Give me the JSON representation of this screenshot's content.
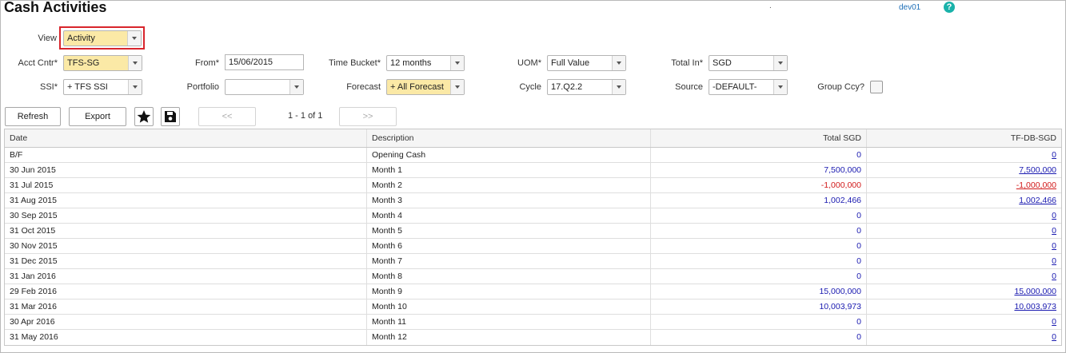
{
  "header": {
    "title": "Cash Activities",
    "dot": ".",
    "user": "dev01",
    "help_label": "?"
  },
  "filters": {
    "view": {
      "label": "View",
      "value": "Activity"
    },
    "acct_cntr": {
      "label": "Acct Cntr*",
      "value": "TFS-SG"
    },
    "from": {
      "label": "From*",
      "value": "15/06/2015"
    },
    "time_bucket": {
      "label": "Time Bucket*",
      "value": "12 months"
    },
    "uom": {
      "label": "UOM*",
      "value": "Full Value"
    },
    "total_in": {
      "label": "Total In*",
      "value": "SGD"
    },
    "ssi": {
      "label": "SSI*",
      "value": "+ TFS SSI"
    },
    "portfolio": {
      "label": "Portfolio",
      "value": ""
    },
    "forecast": {
      "label": "Forecast",
      "value": "+ All Forecast"
    },
    "cycle": {
      "label": "Cycle",
      "value": "17.Q2.2"
    },
    "source": {
      "label": "Source",
      "value": "-DEFAULT-"
    },
    "group_ccy": {
      "label": "Group Ccy?"
    }
  },
  "toolbar": {
    "refresh_label": "Refresh",
    "export_label": "Export",
    "prev_label": "<<",
    "next_label": ">>",
    "pager_text": "1 - 1 of 1"
  },
  "table": {
    "columns": [
      "Date",
      "Description",
      "Total SGD",
      "TF-DB-SGD"
    ],
    "rows": [
      {
        "date": "B/F",
        "desc": "Opening Cash",
        "total": "0",
        "tfdb": "0",
        "neg": false
      },
      {
        "date": "30 Jun 2015",
        "desc": "Month 1",
        "total": "7,500,000",
        "tfdb": "7,500,000",
        "neg": false
      },
      {
        "date": "31 Jul 2015",
        "desc": "Month 2",
        "total": "-1,000,000",
        "tfdb": "-1,000,000",
        "neg": true
      },
      {
        "date": "31 Aug 2015",
        "desc": "Month 3",
        "total": "1,002,466",
        "tfdb": "1,002,466",
        "neg": false
      },
      {
        "date": "30 Sep 2015",
        "desc": "Month 4",
        "total": "0",
        "tfdb": "0",
        "neg": false
      },
      {
        "date": "31 Oct 2015",
        "desc": "Month 5",
        "total": "0",
        "tfdb": "0",
        "neg": false
      },
      {
        "date": "30 Nov 2015",
        "desc": "Month 6",
        "total": "0",
        "tfdb": "0",
        "neg": false
      },
      {
        "date": "31 Dec 2015",
        "desc": "Month 7",
        "total": "0",
        "tfdb": "0",
        "neg": false
      },
      {
        "date": "31 Jan 2016",
        "desc": "Month 8",
        "total": "0",
        "tfdb": "0",
        "neg": false
      },
      {
        "date": "29 Feb 2016",
        "desc": "Month 9",
        "total": "15,000,000",
        "tfdb": "15,000,000",
        "neg": false
      },
      {
        "date": "31 Mar 2016",
        "desc": "Month 10",
        "total": "10,003,973",
        "tfdb": "10,003,973",
        "neg": false
      },
      {
        "date": "30 Apr 2016",
        "desc": "Month 11",
        "total": "0",
        "tfdb": "0",
        "neg": false
      },
      {
        "date": "31 May 2016",
        "desc": "Month 12",
        "total": "0",
        "tfdb": "0",
        "neg": false
      }
    ]
  },
  "colors": {
    "positive": "#1a1ab0",
    "negative": "#d11a1a",
    "highlight_border": "#d8252c",
    "required_field": "#fbe9a6",
    "help_icon": "#1ab2aa"
  },
  "icons": {
    "favorite": "star-icon",
    "save": "floppy-disk-icon",
    "help": "help-icon",
    "dropdown": "chevron-down-icon"
  }
}
